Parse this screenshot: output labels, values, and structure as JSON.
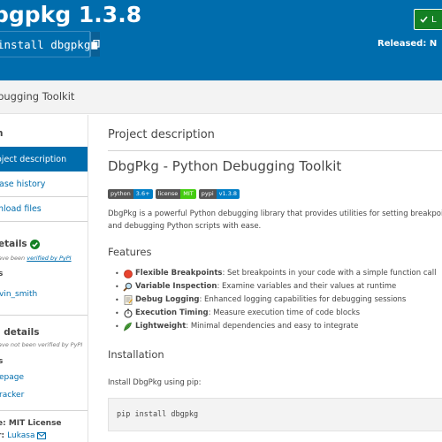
{
  "header": {
    "title": "bgpkg 1.3.8",
    "pip_command": "install dbgpkg",
    "latest_label": "L",
    "released_label": "Released: N"
  },
  "summary": "ebugging Toolkit",
  "sidebar": {
    "nav_heading": "n",
    "nav_items": [
      {
        "label": "oject description",
        "active": true
      },
      {
        "label": "ase history",
        "active": false
      },
      {
        "label": "nload files",
        "active": false
      }
    ],
    "verified": {
      "heading": "etails",
      "note_prefix": "ave been ",
      "note_link": "verified by PyPI",
      "sub_heading": "s",
      "maintainer": "vin_smith"
    },
    "unverified": {
      "heading": "l details",
      "note": "ave not been verified by PyPI",
      "sub_heading": "s",
      "links": [
        "epage",
        "racker"
      ],
      "license": "e: MIT License",
      "author_prefix": "r: ",
      "author_link": "Lukasa"
    }
  },
  "main": {
    "section_title": "Project description",
    "h1": "DbgPkg - Python Debugging Toolkit",
    "badges": [
      {
        "left": "python",
        "right": "3.6+",
        "color": "#007ec6"
      },
      {
        "left": "license",
        "right": "MIT",
        "color": "#4c1"
      },
      {
        "left": "pypi",
        "right": "v1.3.8",
        "color": "#007ec6"
      }
    ],
    "description_lines": [
      "DbgPkg is a powerful Python debugging library that provides utilities for setting breakpoints, inspecting va",
      "and debugging Python scripts with ease."
    ],
    "features_heading": "Features",
    "features": [
      {
        "icon": "red-circle-icon",
        "name": "Flexible Breakpoints",
        "desc": ": Set breakpoints in your code with a simple function call"
      },
      {
        "icon": "magnifier-icon",
        "name": "Variable Inspection",
        "desc": ": Examine variables and their values at runtime"
      },
      {
        "icon": "memo-icon",
        "name": "Debug Logging",
        "desc": ": Enhanced logging capabilities for debugging sessions"
      },
      {
        "icon": "stopwatch-icon",
        "name": "Execution Timing",
        "desc": ": Measure execution time of code blocks"
      },
      {
        "icon": "feather-icon",
        "name": "Lightweight",
        "desc": ": Minimal dependencies and easy to integrate"
      }
    ],
    "installation_heading": "Installation",
    "install_text": "Install DbgPkg using pip:",
    "install_code": "pip install dbgpkg"
  },
  "colors": {
    "header_bg": "#006dad",
    "link": "#006dad",
    "latest_btn": "#148024",
    "verified": "#148024"
  }
}
